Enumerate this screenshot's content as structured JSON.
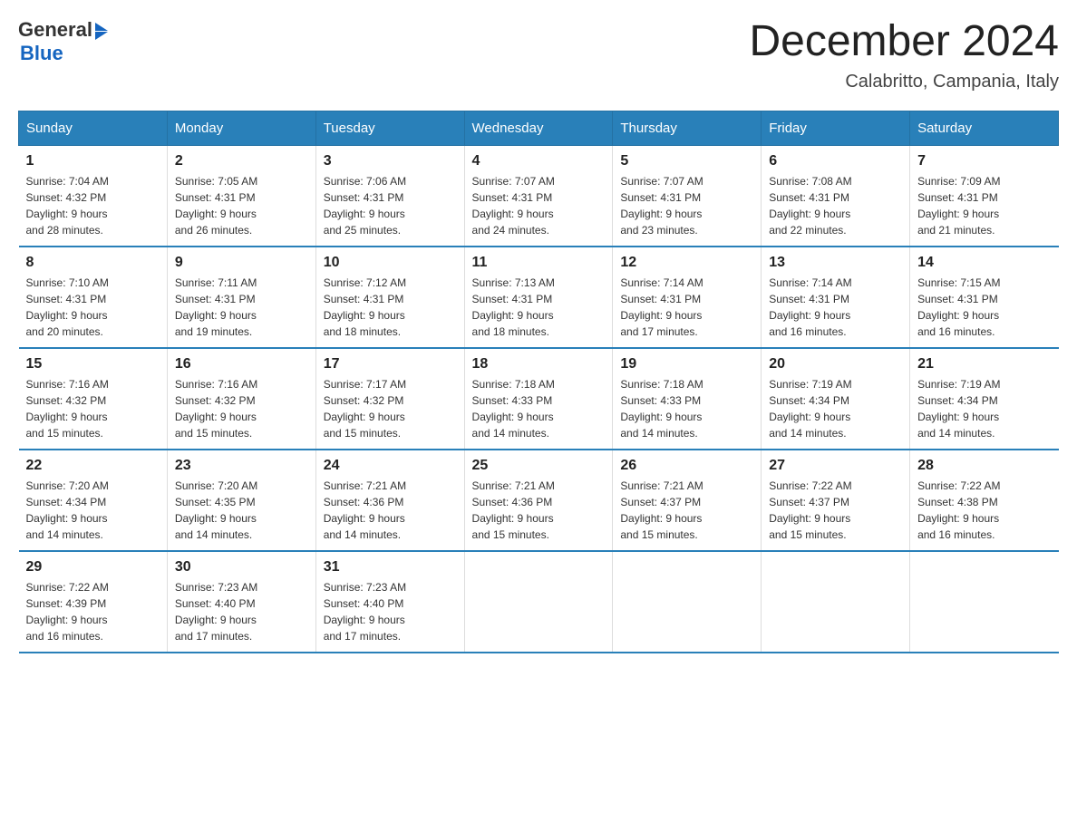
{
  "header": {
    "logo": {
      "general": "General",
      "blue": "Blue"
    },
    "title": "December 2024",
    "location": "Calabritto, Campania, Italy"
  },
  "days_of_week": [
    "Sunday",
    "Monday",
    "Tuesday",
    "Wednesday",
    "Thursday",
    "Friday",
    "Saturday"
  ],
  "weeks": [
    [
      {
        "day": "1",
        "sunrise": "7:04 AM",
        "sunset": "4:32 PM",
        "daylight": "9 hours and 28 minutes."
      },
      {
        "day": "2",
        "sunrise": "7:05 AM",
        "sunset": "4:31 PM",
        "daylight": "9 hours and 26 minutes."
      },
      {
        "day": "3",
        "sunrise": "7:06 AM",
        "sunset": "4:31 PM",
        "daylight": "9 hours and 25 minutes."
      },
      {
        "day": "4",
        "sunrise": "7:07 AM",
        "sunset": "4:31 PM",
        "daylight": "9 hours and 24 minutes."
      },
      {
        "day": "5",
        "sunrise": "7:07 AM",
        "sunset": "4:31 PM",
        "daylight": "9 hours and 23 minutes."
      },
      {
        "day": "6",
        "sunrise": "7:08 AM",
        "sunset": "4:31 PM",
        "daylight": "9 hours and 22 minutes."
      },
      {
        "day": "7",
        "sunrise": "7:09 AM",
        "sunset": "4:31 PM",
        "daylight": "9 hours and 21 minutes."
      }
    ],
    [
      {
        "day": "8",
        "sunrise": "7:10 AM",
        "sunset": "4:31 PM",
        "daylight": "9 hours and 20 minutes."
      },
      {
        "day": "9",
        "sunrise": "7:11 AM",
        "sunset": "4:31 PM",
        "daylight": "9 hours and 19 minutes."
      },
      {
        "day": "10",
        "sunrise": "7:12 AM",
        "sunset": "4:31 PM",
        "daylight": "9 hours and 18 minutes."
      },
      {
        "day": "11",
        "sunrise": "7:13 AM",
        "sunset": "4:31 PM",
        "daylight": "9 hours and 18 minutes."
      },
      {
        "day": "12",
        "sunrise": "7:14 AM",
        "sunset": "4:31 PM",
        "daylight": "9 hours and 17 minutes."
      },
      {
        "day": "13",
        "sunrise": "7:14 AM",
        "sunset": "4:31 PM",
        "daylight": "9 hours and 16 minutes."
      },
      {
        "day": "14",
        "sunrise": "7:15 AM",
        "sunset": "4:31 PM",
        "daylight": "9 hours and 16 minutes."
      }
    ],
    [
      {
        "day": "15",
        "sunrise": "7:16 AM",
        "sunset": "4:32 PM",
        "daylight": "9 hours and 15 minutes."
      },
      {
        "day": "16",
        "sunrise": "7:16 AM",
        "sunset": "4:32 PM",
        "daylight": "9 hours and 15 minutes."
      },
      {
        "day": "17",
        "sunrise": "7:17 AM",
        "sunset": "4:32 PM",
        "daylight": "9 hours and 15 minutes."
      },
      {
        "day": "18",
        "sunrise": "7:18 AM",
        "sunset": "4:33 PM",
        "daylight": "9 hours and 14 minutes."
      },
      {
        "day": "19",
        "sunrise": "7:18 AM",
        "sunset": "4:33 PM",
        "daylight": "9 hours and 14 minutes."
      },
      {
        "day": "20",
        "sunrise": "7:19 AM",
        "sunset": "4:34 PM",
        "daylight": "9 hours and 14 minutes."
      },
      {
        "day": "21",
        "sunrise": "7:19 AM",
        "sunset": "4:34 PM",
        "daylight": "9 hours and 14 minutes."
      }
    ],
    [
      {
        "day": "22",
        "sunrise": "7:20 AM",
        "sunset": "4:34 PM",
        "daylight": "9 hours and 14 minutes."
      },
      {
        "day": "23",
        "sunrise": "7:20 AM",
        "sunset": "4:35 PM",
        "daylight": "9 hours and 14 minutes."
      },
      {
        "day": "24",
        "sunrise": "7:21 AM",
        "sunset": "4:36 PM",
        "daylight": "9 hours and 14 minutes."
      },
      {
        "day": "25",
        "sunrise": "7:21 AM",
        "sunset": "4:36 PM",
        "daylight": "9 hours and 15 minutes."
      },
      {
        "day": "26",
        "sunrise": "7:21 AM",
        "sunset": "4:37 PM",
        "daylight": "9 hours and 15 minutes."
      },
      {
        "day": "27",
        "sunrise": "7:22 AM",
        "sunset": "4:37 PM",
        "daylight": "9 hours and 15 minutes."
      },
      {
        "day": "28",
        "sunrise": "7:22 AM",
        "sunset": "4:38 PM",
        "daylight": "9 hours and 16 minutes."
      }
    ],
    [
      {
        "day": "29",
        "sunrise": "7:22 AM",
        "sunset": "4:39 PM",
        "daylight": "9 hours and 16 minutes."
      },
      {
        "day": "30",
        "sunrise": "7:23 AM",
        "sunset": "4:40 PM",
        "daylight": "9 hours and 17 minutes."
      },
      {
        "day": "31",
        "sunrise": "7:23 AM",
        "sunset": "4:40 PM",
        "daylight": "9 hours and 17 minutes."
      },
      null,
      null,
      null,
      null
    ]
  ],
  "labels": {
    "sunrise": "Sunrise:",
    "sunset": "Sunset:",
    "daylight": "Daylight:"
  }
}
